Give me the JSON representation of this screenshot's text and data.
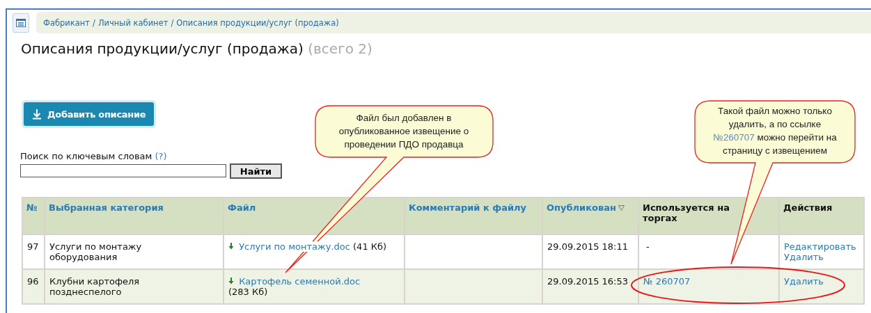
{
  "breadcrumb": {
    "separator": "/",
    "items": [
      "Фабрикант",
      "Личный кабинет",
      "Описания продукции/услуг (продажа)"
    ]
  },
  "title": "Описания продукции/услуг (продажа)",
  "count": "(всего 2)",
  "add_button": "Добавить описание",
  "search": {
    "label": "Поиск по ключевым словам",
    "help": "(?)",
    "button": "Найти"
  },
  "table": {
    "columns": [
      {
        "label": "№",
        "kind": "link",
        "sorted": false
      },
      {
        "label": "Выбранная категория",
        "kind": "link",
        "sorted": false
      },
      {
        "label": "Файл",
        "kind": "link",
        "sorted": false
      },
      {
        "label": "Комментарий к файлу",
        "kind": "link",
        "sorted": false
      },
      {
        "label": "Опубликован",
        "kind": "link",
        "sorted": true
      },
      {
        "label": "Используется на торгах",
        "kind": "plain",
        "sorted": false
      },
      {
        "label": "Действия",
        "kind": "plain",
        "sorted": false
      }
    ],
    "rows": [
      {
        "number": "97",
        "category": "Услуги по монтажу оборудования",
        "file": "Услуги по монтажу.doc",
        "size": "(41 Кб)",
        "published": "29.09.2015 18:11",
        "used_on": {
          "kind": "text",
          "text": "-"
        },
        "actions": [
          "Редактировать",
          "Удалить"
        ]
      },
      {
        "number": "96",
        "category": "Клубни картофеля позднеспелого",
        "file": "Картофель семенной.doc",
        "size": "(283 Кб)",
        "published": "29.09.2015 16:53",
        "used_on": {
          "kind": "link",
          "text": "№ 260707"
        },
        "actions": [
          "Удалить"
        ]
      }
    ]
  },
  "callouts": [
    {
      "parts": [
        {
          "kind": "text",
          "text": "Файл был добавлен в опубликованное извещение о проведении ПДО продавца"
        }
      ]
    },
    {
      "parts": [
        {
          "kind": "text",
          "text": "Такой файл можно только удалить, а по ссылке "
        },
        {
          "kind": "link",
          "text": "№260707"
        },
        {
          "kind": "text",
          "text": " можно перейти на страницу с извещением"
        }
      ]
    }
  ]
}
